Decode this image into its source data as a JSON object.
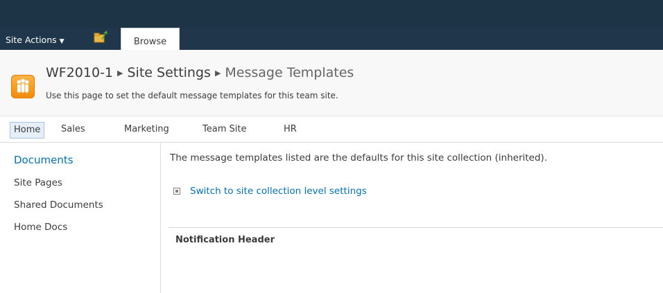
{
  "ribbon": {
    "site_actions_label": "Site Actions",
    "tab_browse": "Browse"
  },
  "title_area": {
    "breadcrumb": [
      "WF2010-1",
      "Site Settings",
      "Message Templates"
    ],
    "description": "Use this page to set the default message templates for this team site."
  },
  "topnav": {
    "items": [
      "Home",
      "Sales",
      "Marketing",
      "Team Site",
      "HR"
    ],
    "selected": "Home"
  },
  "leftnav": {
    "heading": "Documents",
    "items": [
      "Site Pages",
      "Shared Documents",
      "Home Docs"
    ]
  },
  "main": {
    "info_text": "The message templates listed are the defaults for this site collection (inherited).",
    "switch_link": "Switch to site collection level settings",
    "section_label": "Notification Header"
  },
  "colors": {
    "ribbon_bg": "#1f364b",
    "link_blue": "#0072bc",
    "selected_tab_bg": "#e6eff8",
    "logo_orange": "#f28c0b"
  }
}
